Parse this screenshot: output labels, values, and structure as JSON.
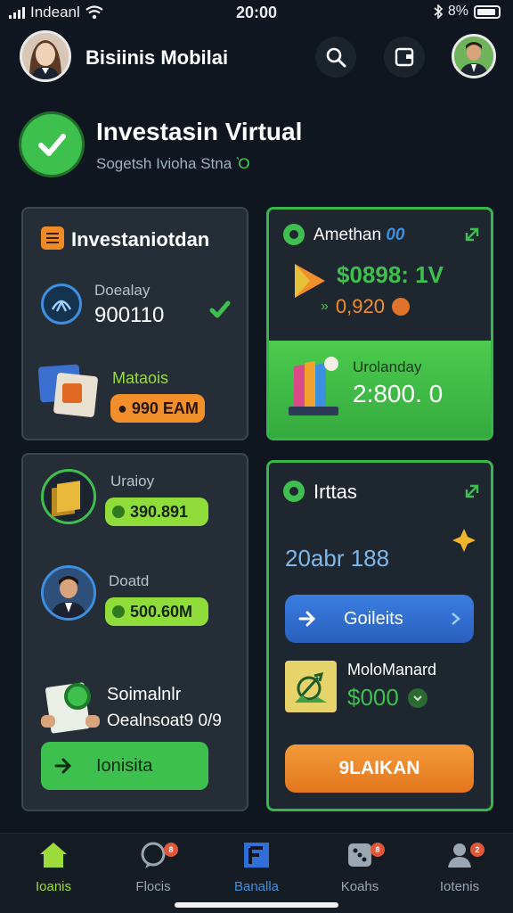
{
  "status": {
    "carrier": "Indeanl",
    "time": "20:00",
    "battery": "8%"
  },
  "header": {
    "title": "Bisiinis Mobilai"
  },
  "hero": {
    "title": "Investasin Virtual",
    "subtitle": "Sogetsh Ivioha Stna",
    "subtitle_glyph": "Ὸ"
  },
  "card1": {
    "title": "Investaniotdan",
    "row1_label": "Doealay",
    "row1_value": "900110",
    "row2_label": "Mataois",
    "row2_pill": "● 990 EAM"
  },
  "card2": {
    "title": "Amethan",
    "title_suffix": "00",
    "top_value": "$0898: 1V",
    "sub_prefix": "»",
    "sub_value": "0,920",
    "bottom_label": "Urolanday",
    "bottom_value": "2:800. 0"
  },
  "card3": {
    "row1_label": "Uraioy",
    "row1_pill": "390.891",
    "row2_label": "Doatd",
    "row2_pill": "500.60M",
    "row3_title": "Soimalnlr",
    "row3_sub": "Oealnsoat9 0/9",
    "button_label": "Ionisita"
  },
  "card4": {
    "title": "Irttas",
    "value": "20abr 188",
    "blue_button": "Goileits",
    "sub_title": "MoloManard",
    "sub_value": "$000",
    "orange_button": "9LAIKAN"
  },
  "nav": {
    "items": [
      {
        "label": "Ioanis"
      },
      {
        "label": "Flocis",
        "badge": "8"
      },
      {
        "label": "Banalla"
      },
      {
        "label": "Koahs",
        "badge": "8"
      },
      {
        "label": "Iotenis",
        "badge": "2"
      }
    ]
  },
  "colors": {
    "bg": "#0f1620",
    "green": "#3ec04e",
    "orange": "#f28f2b",
    "blue": "#2f6fd6",
    "lime": "#8fdc3a"
  }
}
